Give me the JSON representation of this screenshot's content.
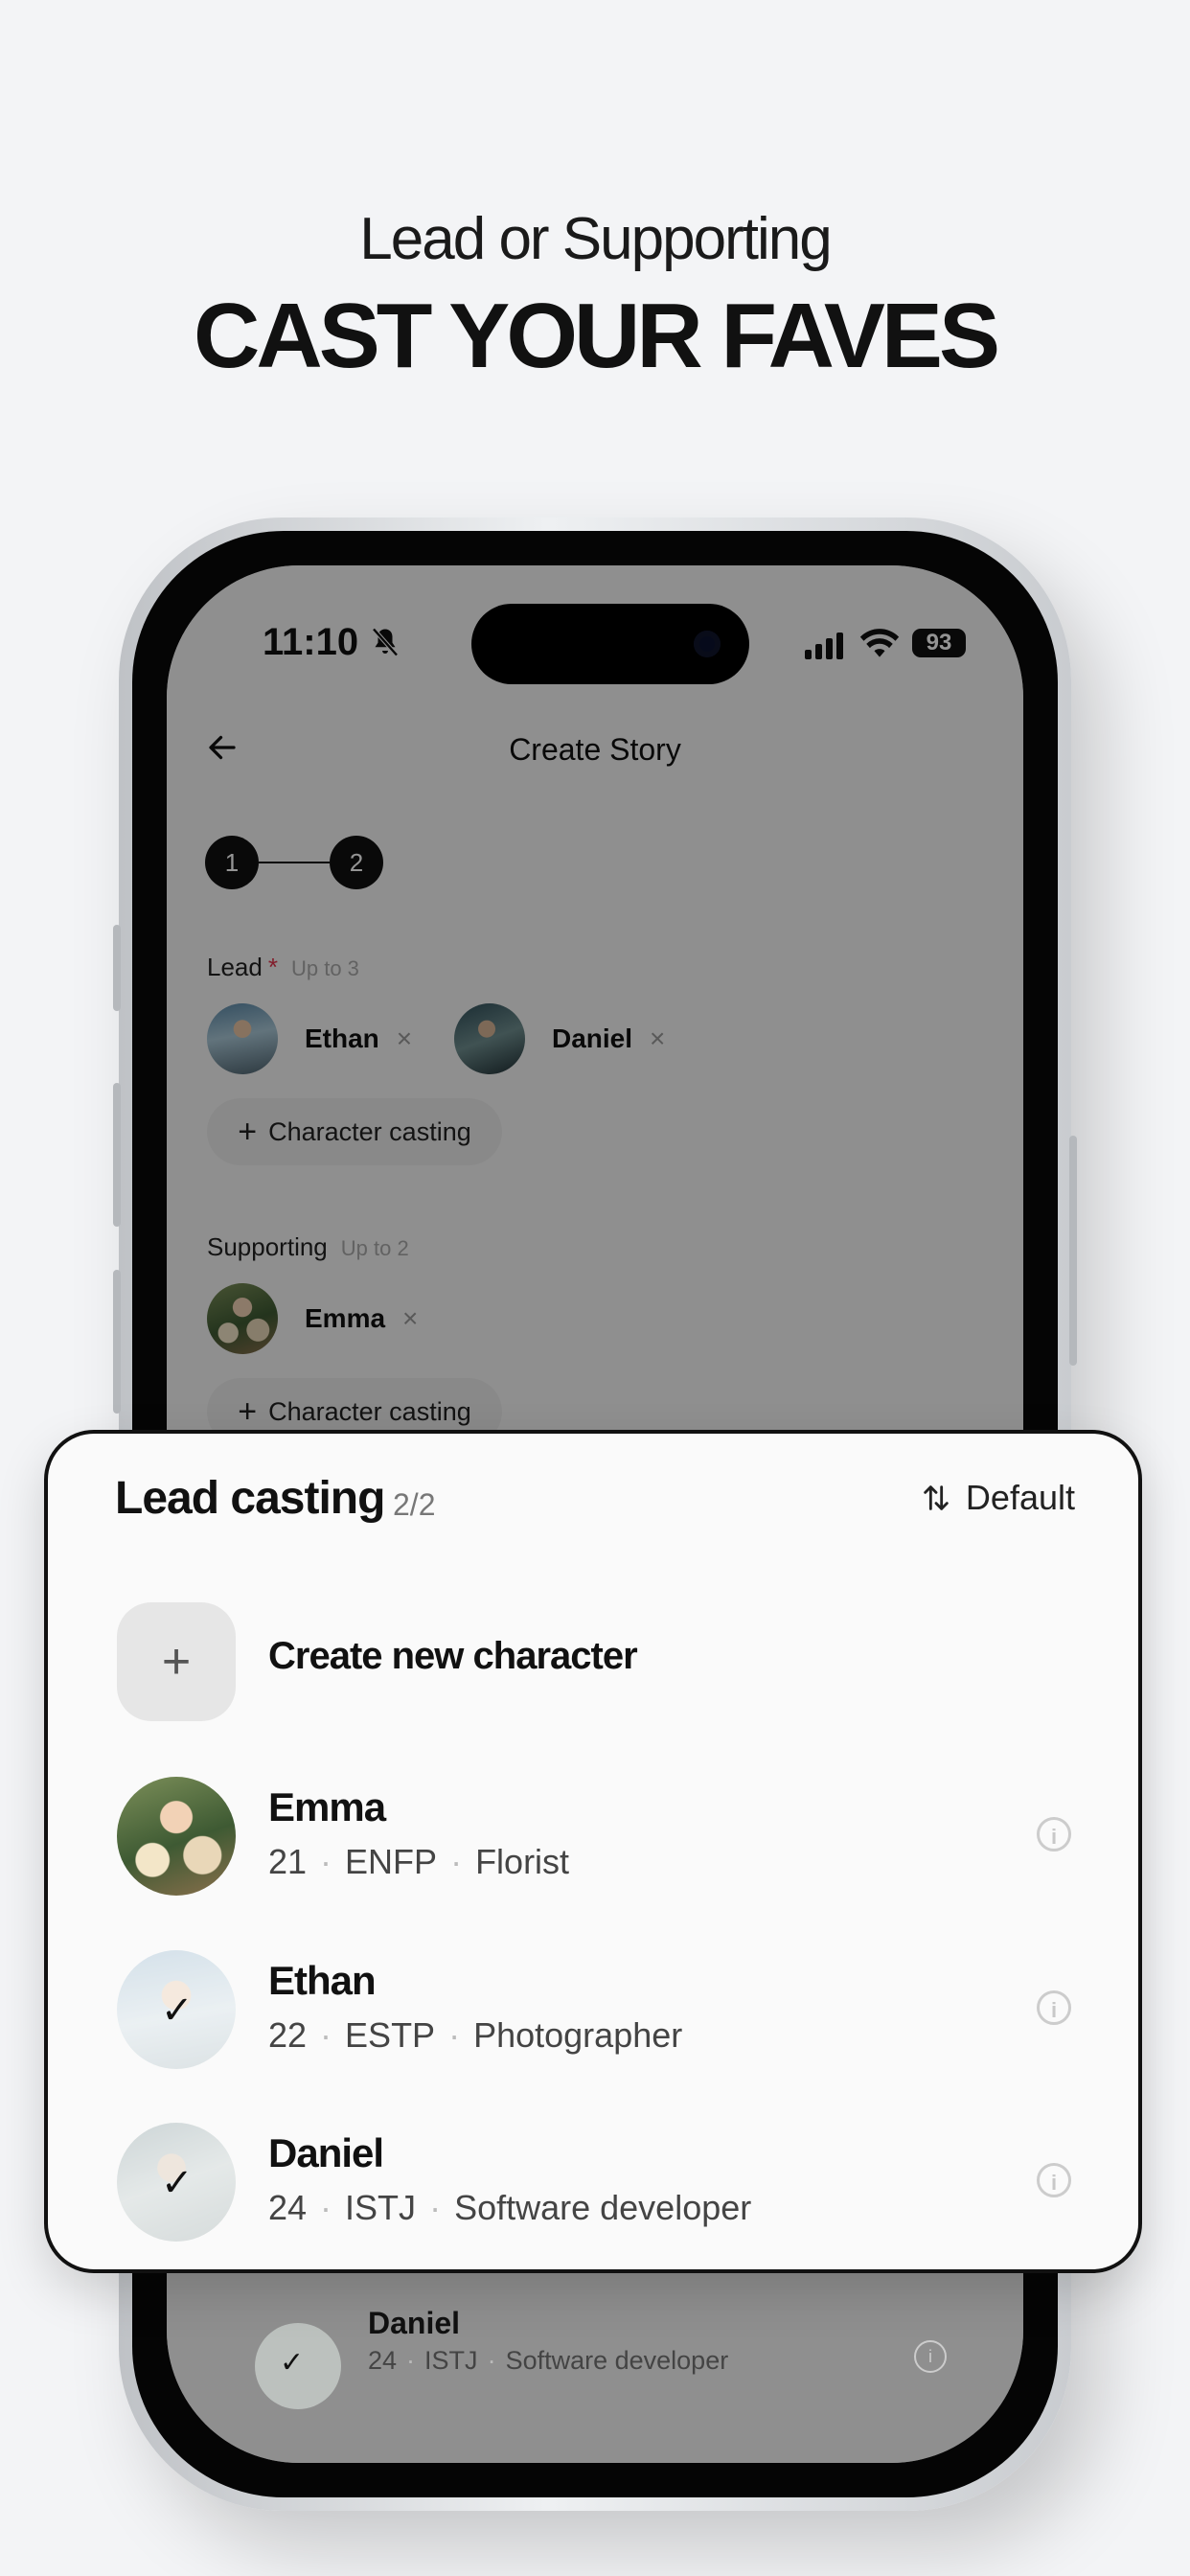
{
  "headline": {
    "sub": "Lead or Supporting",
    "main": "CAST YOUR FAVES"
  },
  "status_bar": {
    "time": "11:10",
    "battery": "93"
  },
  "nav": {
    "title": "Create Story"
  },
  "steps": [
    "1",
    "2"
  ],
  "lead": {
    "label": "Lead",
    "required": "*",
    "hint": "Up to 3",
    "chips": [
      {
        "name": "Ethan"
      },
      {
        "name": "Daniel"
      }
    ],
    "cast_button": "Character casting"
  },
  "supporting": {
    "label": "Supporting",
    "hint": "Up to 2",
    "chips": [
      {
        "name": "Emma"
      }
    ],
    "cast_button": "Character casting"
  },
  "remove_symbol": "×",
  "sheet": {
    "title": "Lead casting",
    "count": "2/2",
    "sort_label": "Default",
    "create_label": "Create new character",
    "characters": [
      {
        "name": "Emma",
        "age": "21",
        "mbti": "ENFP",
        "job": "Florist",
        "selected": false
      },
      {
        "name": "Ethan",
        "age": "22",
        "mbti": "ESTP",
        "job": "Photographer",
        "selected": true
      },
      {
        "name": "Daniel",
        "age": "24",
        "mbti": "ISTJ",
        "job": "Software developer",
        "selected": true
      }
    ]
  },
  "background_row": {
    "name": "Daniel",
    "age": "24",
    "mbti": "ISTJ",
    "job": "Software developer"
  },
  "icons": {
    "back": "arrow-left-icon",
    "bell_muted": "bell-slash-icon",
    "signal": "cellular-signal-icon",
    "wifi": "wifi-icon",
    "sort": "sort-arrows-icon",
    "add": "plus-icon",
    "check": "checkmark-icon",
    "info": "info-circle-icon"
  },
  "colors": {
    "accent_required": "#e0334a",
    "primary": "#111111",
    "overlay": "rgba(0,0,0,0.42)"
  }
}
